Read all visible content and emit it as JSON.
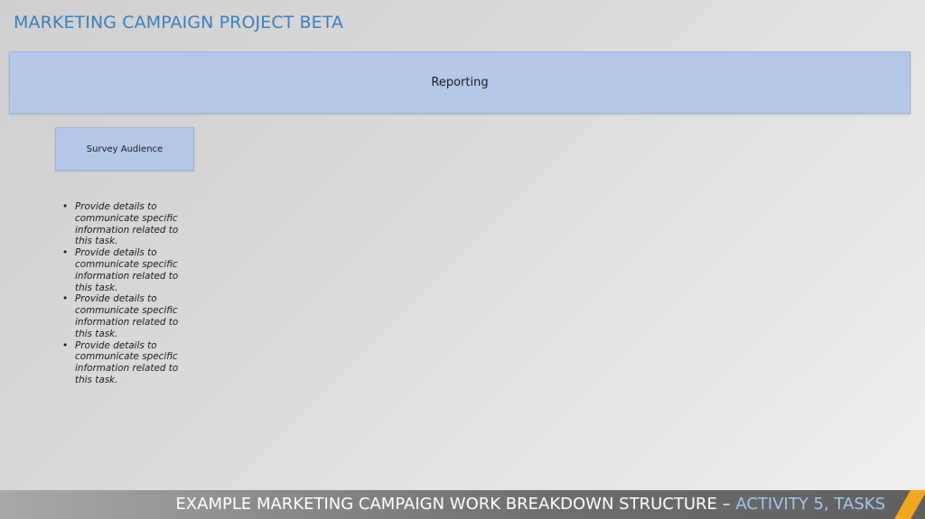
{
  "slide": {
    "title": "MARKETING CAMPAIGN PROJECT BETA"
  },
  "wbs": {
    "main_task": "Reporting",
    "sub_task": "Survey Audience",
    "details": [
      "Provide details to communicate specific information related to this task.",
      "Provide details to communicate specific information related to this task.",
      "Provide details to communicate specific information related to this task.",
      "Provide details to communicate specific information related to this task."
    ]
  },
  "footer": {
    "text": "EXAMPLE MARKETING CAMPAIGN WORK BREAKDOWN STRUCTURE – ",
    "accent": "ACTIVITY 5, TASKS"
  },
  "colors": {
    "title": "#3a7fc1",
    "box_fill": "#b3c8e8",
    "footer_accent": "#a8c4ec",
    "stripe": "#f0a820"
  }
}
